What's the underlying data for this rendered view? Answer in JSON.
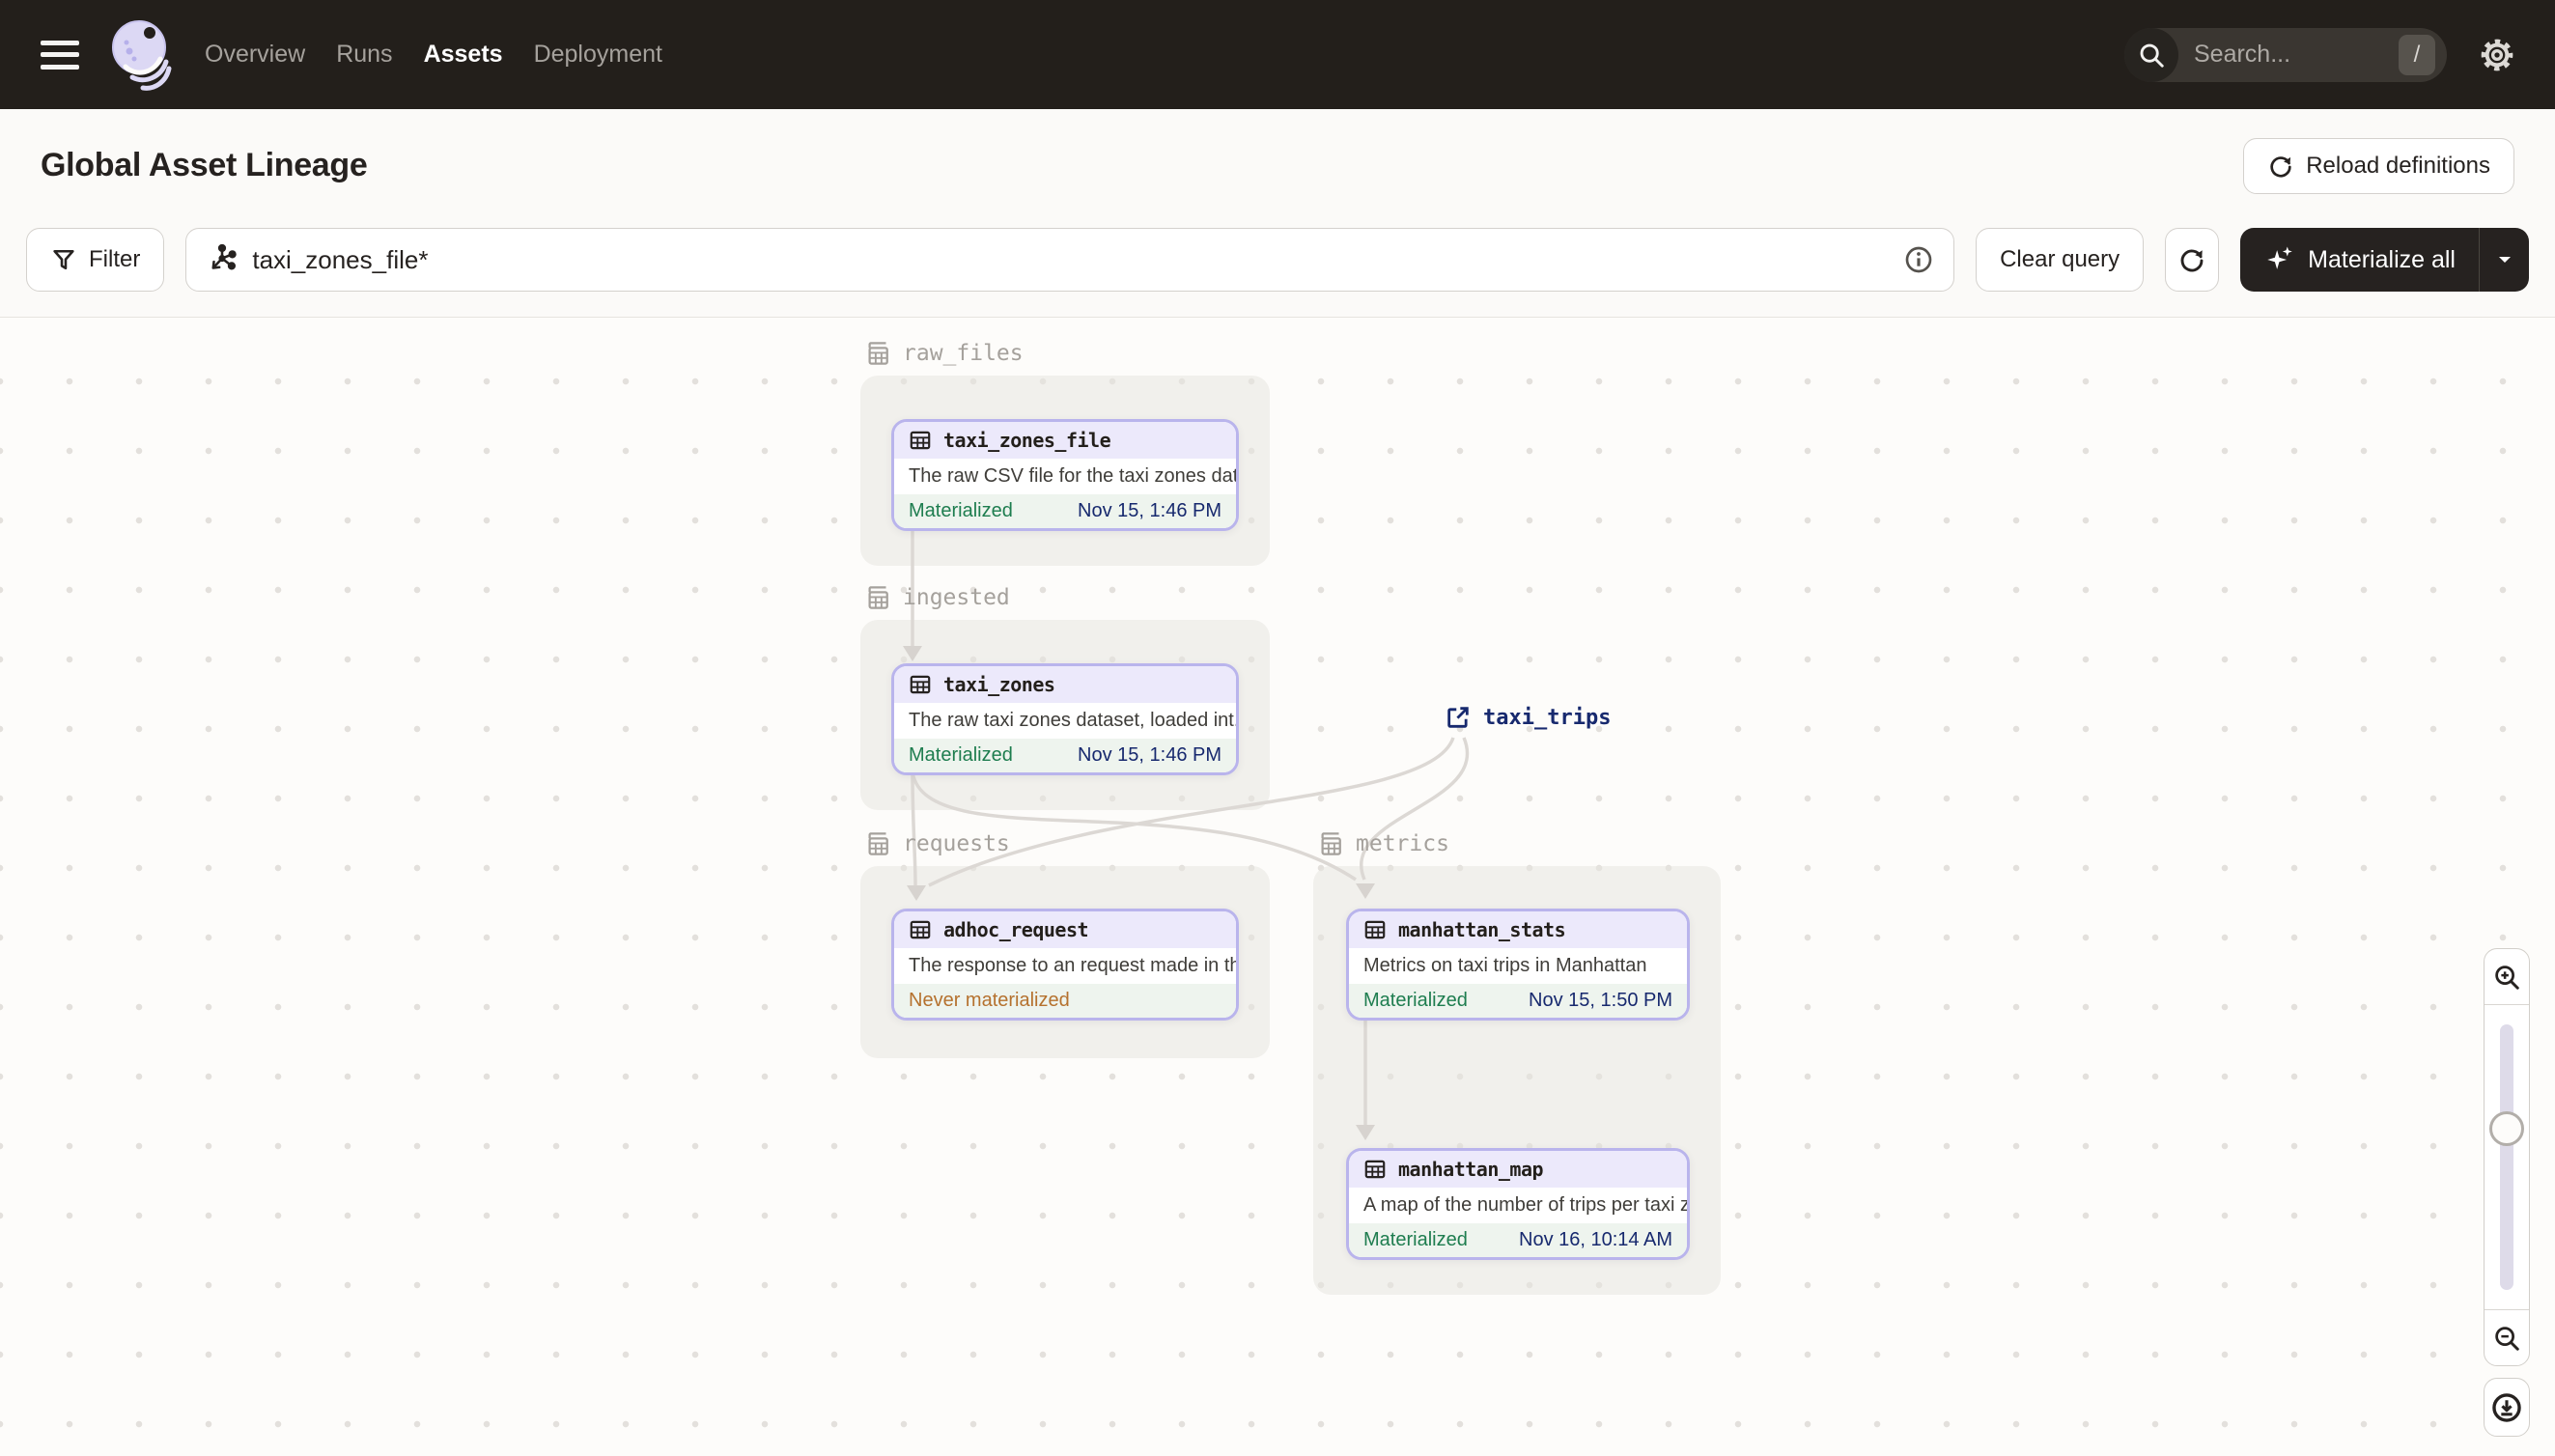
{
  "nav": {
    "links": [
      {
        "label": "Overview"
      },
      {
        "label": "Runs"
      },
      {
        "label": "Assets"
      },
      {
        "label": "Deployment"
      }
    ],
    "active_link": "Assets",
    "search": {
      "placeholder": "Search...",
      "shortcut_key": "/"
    }
  },
  "header": {
    "title": "Global Asset Lineage",
    "reload_button": "Reload definitions"
  },
  "toolbar": {
    "filter_button": "Filter",
    "query_value": "taxi_zones_file*",
    "clear_button": "Clear query",
    "materialize_button": "Materialize all"
  },
  "graph": {
    "groups": [
      {
        "name": "raw_files"
      },
      {
        "name": "ingested"
      },
      {
        "name": "requests"
      },
      {
        "name": "metrics"
      }
    ],
    "nodes": [
      {
        "name": "taxi_zones_file",
        "description": "The raw CSV file for the taxi zones dat...",
        "status": "Materialized",
        "timestamp": "Nov 15, 1:46 PM"
      },
      {
        "name": "taxi_zones",
        "description": "The raw taxi zones dataset, loaded int...",
        "status": "Materialized",
        "timestamp": "Nov 15, 1:46 PM"
      },
      {
        "name": "adhoc_request",
        "description": "The response to an request made in th...",
        "status": "Never materialized",
        "timestamp": ""
      },
      {
        "name": "manhattan_stats",
        "description": "Metrics on taxi trips in Manhattan",
        "status": "Materialized",
        "timestamp": "Nov 15, 1:50 PM"
      },
      {
        "name": "manhattan_map",
        "description": "A map of the number of trips per taxi z...",
        "status": "Materialized",
        "timestamp": "Nov 16, 10:14 AM"
      }
    ],
    "external_node": {
      "name": "taxi_trips"
    }
  },
  "icons": {
    "hamburger": "menu-icon",
    "logo": "dagster-logo",
    "search": "magnifier",
    "settings": "gear",
    "reload": "circular-arrow",
    "filter": "funnel",
    "query": "asset-selection-molecule",
    "info": "circle-i",
    "refresh": "circular-arrow",
    "materialize": "sparkles",
    "asset": "table-grid",
    "group": "layered-tables",
    "external": "external-link-box-arrow",
    "zoom_in": "magnifier-plus",
    "zoom_out": "magnifier-minus",
    "fit": "circle-arrow-down"
  },
  "colors": {
    "topbar_bg": "#231f1b",
    "accent_purple_border": "#b9b4ec",
    "node_header_bg": "#ece9fb",
    "status_green": "#1e7d4f",
    "status_orange": "#b5712e",
    "timestamp_blue": "#17296e",
    "edge_gray": "#dcd8d4",
    "group_label_gray": "#a5a19c"
  }
}
